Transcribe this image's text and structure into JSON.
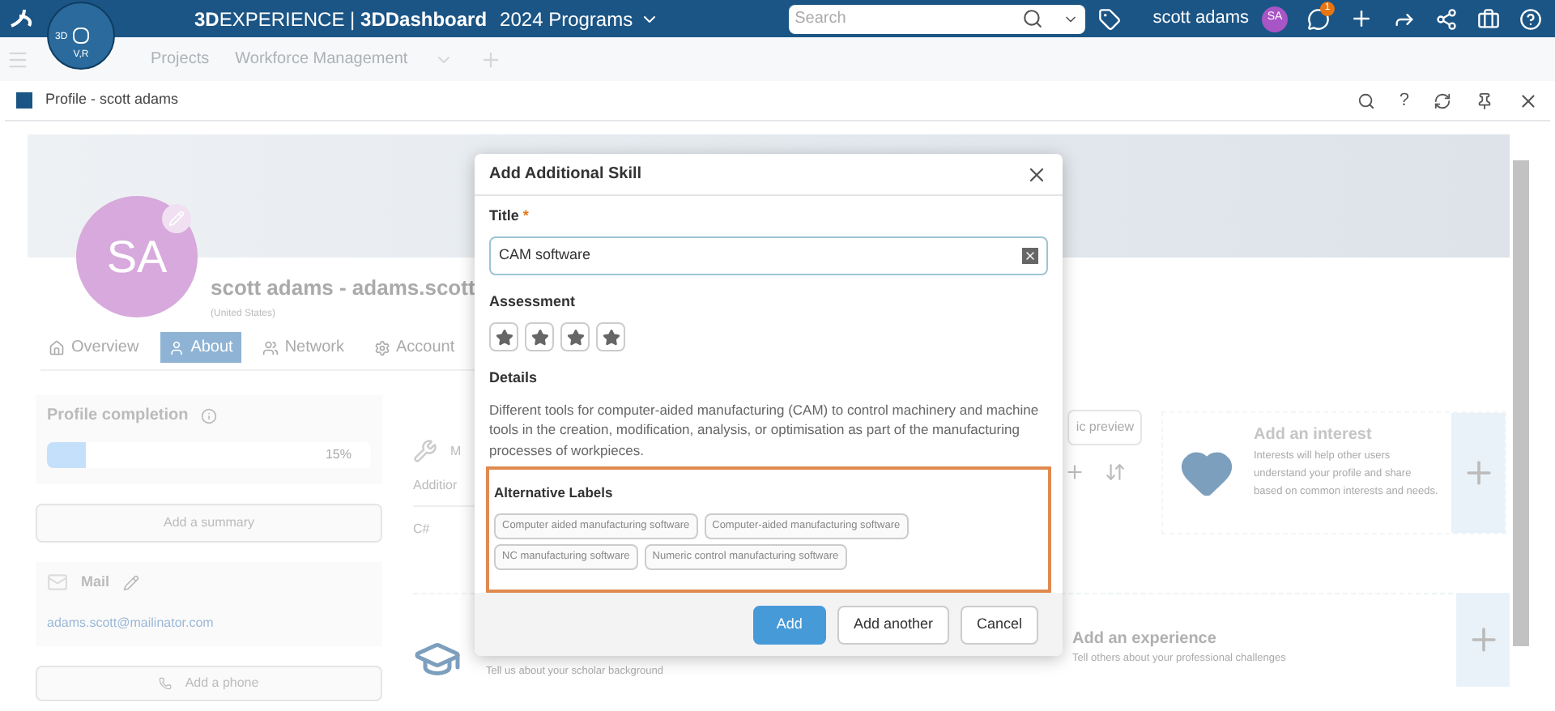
{
  "topbar": {
    "brand": "3DEXPERIENCE",
    "separator": "|",
    "app": "3DDashboard",
    "dashboard": "2024 Programs",
    "search": {
      "placeholder": "Search"
    },
    "user": "scott adams",
    "avatar": "SA",
    "notifications": "1"
  },
  "compass": {
    "left": "3D",
    "bottom": "V,R"
  },
  "dashboard_tabs": [
    "Projects",
    "Workforce Management"
  ],
  "widget": {
    "title": "Profile - scott adams",
    "help": "?"
  },
  "profile": {
    "avatar": "SA",
    "name": "scott adams - adams.scott",
    "location": "(United States)",
    "tabs": [
      {
        "label": "Overview",
        "selected": false
      },
      {
        "label": "About",
        "selected": true
      },
      {
        "label": "Network",
        "selected": false
      },
      {
        "label": "Account",
        "selected": false
      }
    ],
    "completion": {
      "title": "Profile completion",
      "level": 0.15,
      "reading": "15%"
    },
    "summary_button": "Add a summary",
    "mail": {
      "title": "Mail",
      "address": "adams.scott@mailinator.com"
    },
    "phone_button": "Add a phone",
    "skills": {
      "title": "M",
      "column": "Additior",
      "row": "C#",
      "preview_button": "ic preview"
    },
    "interest": {
      "title": "Add an interest",
      "text": "Interests will help other users understand your profile and share based on common interests and needs."
    },
    "scholar": {
      "text": "Tell us about your scholar background"
    },
    "experience": {
      "title": "Add an experience",
      "text": "Tell others about your professional challenges"
    }
  },
  "dialog": {
    "title": "Add Additional Skill",
    "title_label": "Title",
    "required_mark": "*",
    "title_value": "CAM software",
    "assessment_label": "Assessment",
    "stars": 4,
    "details_label": "Details",
    "details": "Different tools for computer-aided manufacturing (CAM) to control machinery and machine tools in the creation, modification, analysis, or optimisation as part of the manufacturing processes of workpieces.",
    "labels_title": "Alternative Labels",
    "labels": [
      "Computer aided manufacturing software",
      "Computer-aided manufacturing software",
      "NC manufacturing software",
      "Numeric control manufacturing software"
    ],
    "buttons": [
      {
        "label": "Add",
        "kind": "primary"
      },
      {
        "label": "Add another",
        "kind": "secondary"
      },
      {
        "label": "Cancel",
        "kind": "secondary"
      }
    ]
  }
}
